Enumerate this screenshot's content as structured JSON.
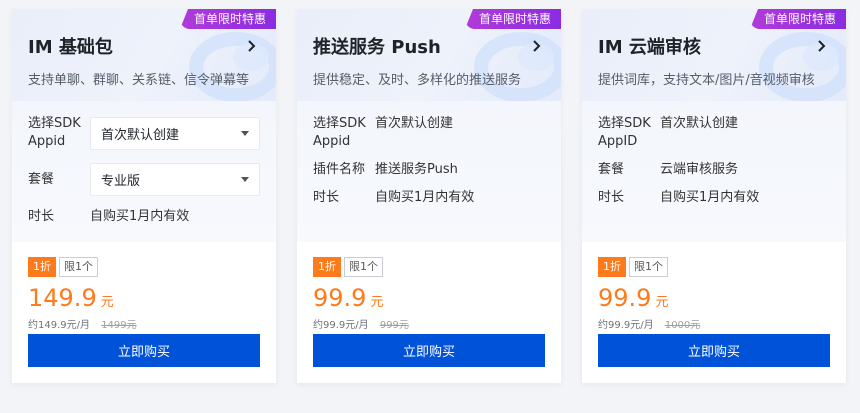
{
  "cards": [
    {
      "promo": "首单限时特惠",
      "title": "IM 基础包",
      "subtitle": "支持单聊、群聊、关系链、信令弹幕等",
      "rows": [
        {
          "label": "选择SDK Appid",
          "value": "首次默认创建",
          "type": "select"
        },
        {
          "label": "套餐",
          "value": "专业版",
          "type": "select"
        },
        {
          "label": "时长",
          "value": "自购买1月内有效",
          "type": "text"
        }
      ],
      "discount": "1折",
      "limit": "限1个",
      "price": "149.9",
      "unit": "元",
      "monthly": "约149.9元/月",
      "original": "1499元",
      "buy": "立即购买"
    },
    {
      "promo": "首单限时特惠",
      "title": "推送服务 Push",
      "subtitle": "提供稳定、及时、多样化的推送服务",
      "rows": [
        {
          "label": "选择SDK Appid",
          "value": "首次默认创建",
          "type": "text"
        },
        {
          "label": "插件名称",
          "value": "推送服务Push",
          "type": "text"
        },
        {
          "label": "时长",
          "value": "自购买1月内有效",
          "type": "text"
        }
      ],
      "discount": "1折",
      "limit": "限1个",
      "price": "99.9",
      "unit": "元",
      "monthly": "约99.9元/月",
      "original": "999元",
      "buy": "立即购买"
    },
    {
      "promo": "首单限时特惠",
      "title": "IM 云端审核",
      "subtitle": "提供词库，支持文本/图片/音视频审核",
      "rows": [
        {
          "label": "选择SDK AppID",
          "value": "首次默认创建",
          "type": "text"
        },
        {
          "label": "套餐",
          "value": "云端审核服务",
          "type": "text"
        },
        {
          "label": "时长",
          "value": "自购买1月内有效",
          "type": "text"
        }
      ],
      "discount": "1折",
      "limit": "限1个",
      "price": "99.9",
      "unit": "元",
      "monthly": "约99.9元/月",
      "original": "1000元",
      "buy": "立即购买"
    }
  ]
}
